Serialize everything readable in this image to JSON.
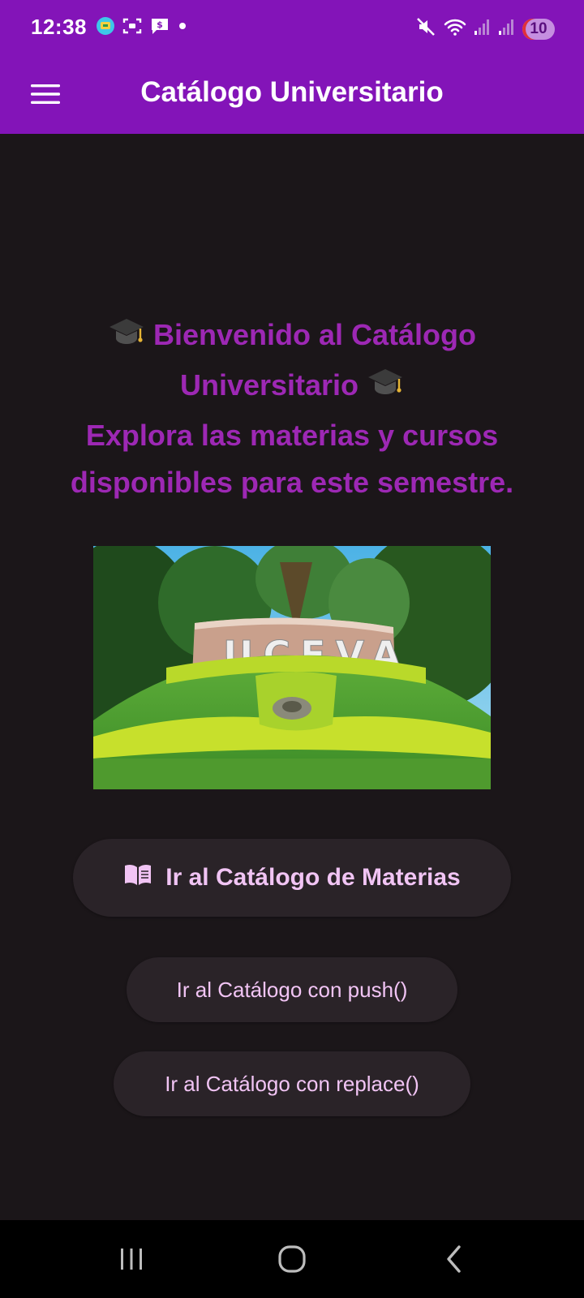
{
  "status_bar": {
    "time": "12:38",
    "battery_level": "10",
    "icons_left": [
      "app-notification-icon",
      "screenshot-icon",
      "message-icon",
      "dot-icon"
    ],
    "icons_right": [
      "mute-icon",
      "wifi-icon",
      "signal-icon",
      "signal-icon"
    ]
  },
  "app_bar": {
    "title": "Catálogo Universitario",
    "menu_icon": "hamburger-menu-icon"
  },
  "welcome": {
    "line1": "Bienvenido al Catálogo",
    "line2": "Universitario",
    "line3": "Explora las materias y cursos",
    "line4": "disponibles para este semestre.",
    "emoji": "🎓"
  },
  "campus_image": {
    "sign_text": "UCEVA"
  },
  "buttons": {
    "main_label": "Ir al Catálogo de Materias",
    "main_icon": "open-book-icon",
    "push_label": "Ir al Catálogo con push()",
    "replace_label": "Ir al Catálogo con replace()"
  },
  "nav_bar": {
    "icons": [
      "recent-apps-icon",
      "home-icon",
      "back-icon"
    ]
  },
  "colors": {
    "app_bar": "#8314b8",
    "background": "#1b1619",
    "welcome_text": "#9d28b4",
    "button_bg": "#2a2328",
    "button_text": "#f1c4f4"
  }
}
